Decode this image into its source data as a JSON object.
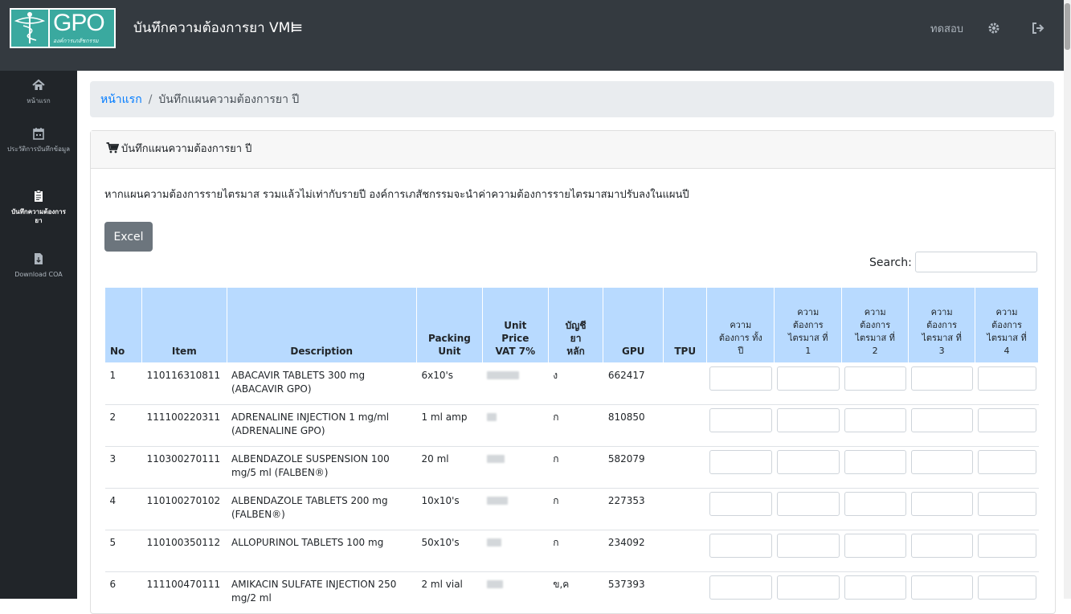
{
  "header": {
    "logo_text": "GPO",
    "logo_subtext": "องค์การเภสัชกรรม",
    "app_title": "บันทึกความต้องการยา VMI",
    "menu_icon": "hamburger-icon",
    "user_name": "ทดสอบ",
    "settings_icon": "gear-icon",
    "signout_icon": "sign-out-icon"
  },
  "sidebar": {
    "items": [
      {
        "icon": "home-icon",
        "label": "หน้าแรก"
      },
      {
        "icon": "calendar-icon",
        "label": "ประวัติการบันทึกข้อมูล"
      },
      {
        "icon": "clipboard-icon",
        "label": "บันทึกความต้องการยา",
        "active": true
      },
      {
        "icon": "file-download-icon",
        "label": "Download COA"
      }
    ]
  },
  "breadcrumb": {
    "home": "หน้าแรก",
    "separator": "/",
    "current": "บันทึกแผนความต้องการยา ปี"
  },
  "card": {
    "title": "บันทึกแผนความต้องการยา ปี",
    "notice": "หากแผนความต้องการรายไตรมาส รวมแล้วไม่เท่ากับรายปี องค์การเภสัชกรรมจะนำค่าความต้องการรายไตรมาสมาปรับลงในแผนปี",
    "excel_button": "Excel",
    "search_label": "Search:"
  },
  "table": {
    "headers": {
      "no": "No",
      "item": "Item",
      "description": "Description",
      "packing_unit": "Packing Unit",
      "unit_price": "Unit Price VAT 7%",
      "drug_list": "บัญชี ยา หลัก",
      "gpu": "GPU",
      "tpu": "TPU",
      "annual": "ความ ต้องการ ทั้งปี",
      "q1": "ความ ต้องการ ไตรมาส ที่ 1",
      "q2": "ความ ต้องการ ไตรมาส ที่ 2",
      "q3": "ความ ต้องการ ไตรมาส ที่ 3",
      "q4": "ความ ต้องการ ไตรมาส ที่ 4"
    },
    "rows": [
      {
        "no": "1",
        "item": "110116310811",
        "description": "ABACAVIR TABLETS 300 mg (ABACAVIR GPO)",
        "packing_unit": "6x10's",
        "drug_list": "ง",
        "gpu": "662417",
        "tpu": ""
      },
      {
        "no": "2",
        "item": "111100220311",
        "description": "ADRENALINE INJECTION 1 mg/ml (ADRENALINE GPO)",
        "packing_unit": "1 ml amp",
        "drug_list": "ก",
        "gpu": "810850",
        "tpu": ""
      },
      {
        "no": "3",
        "item": "110300270111",
        "description": "ALBENDAZOLE SUSPENSION 100 mg/5 ml (FALBEN®)",
        "packing_unit": "20 ml",
        "drug_list": "ก",
        "gpu": "582079",
        "tpu": ""
      },
      {
        "no": "4",
        "item": "110100270102",
        "description": "ALBENDAZOLE TABLETS 200 mg (FALBEN®)",
        "packing_unit": "10x10's",
        "drug_list": "ก",
        "gpu": "227353",
        "tpu": ""
      },
      {
        "no": "5",
        "item": "110100350112",
        "description": "ALLOPURINOL TABLETS 100 mg",
        "packing_unit": "50x10's",
        "drug_list": "ก",
        "gpu": "234092",
        "tpu": ""
      },
      {
        "no": "6",
        "item": "111100470111",
        "description": "AMIKACIN SULFATE INJECTION 250 mg/2 ml",
        "packing_unit": "2 ml vial",
        "drug_list": "ข,ค",
        "gpu": "537393",
        "tpu": ""
      }
    ]
  }
}
